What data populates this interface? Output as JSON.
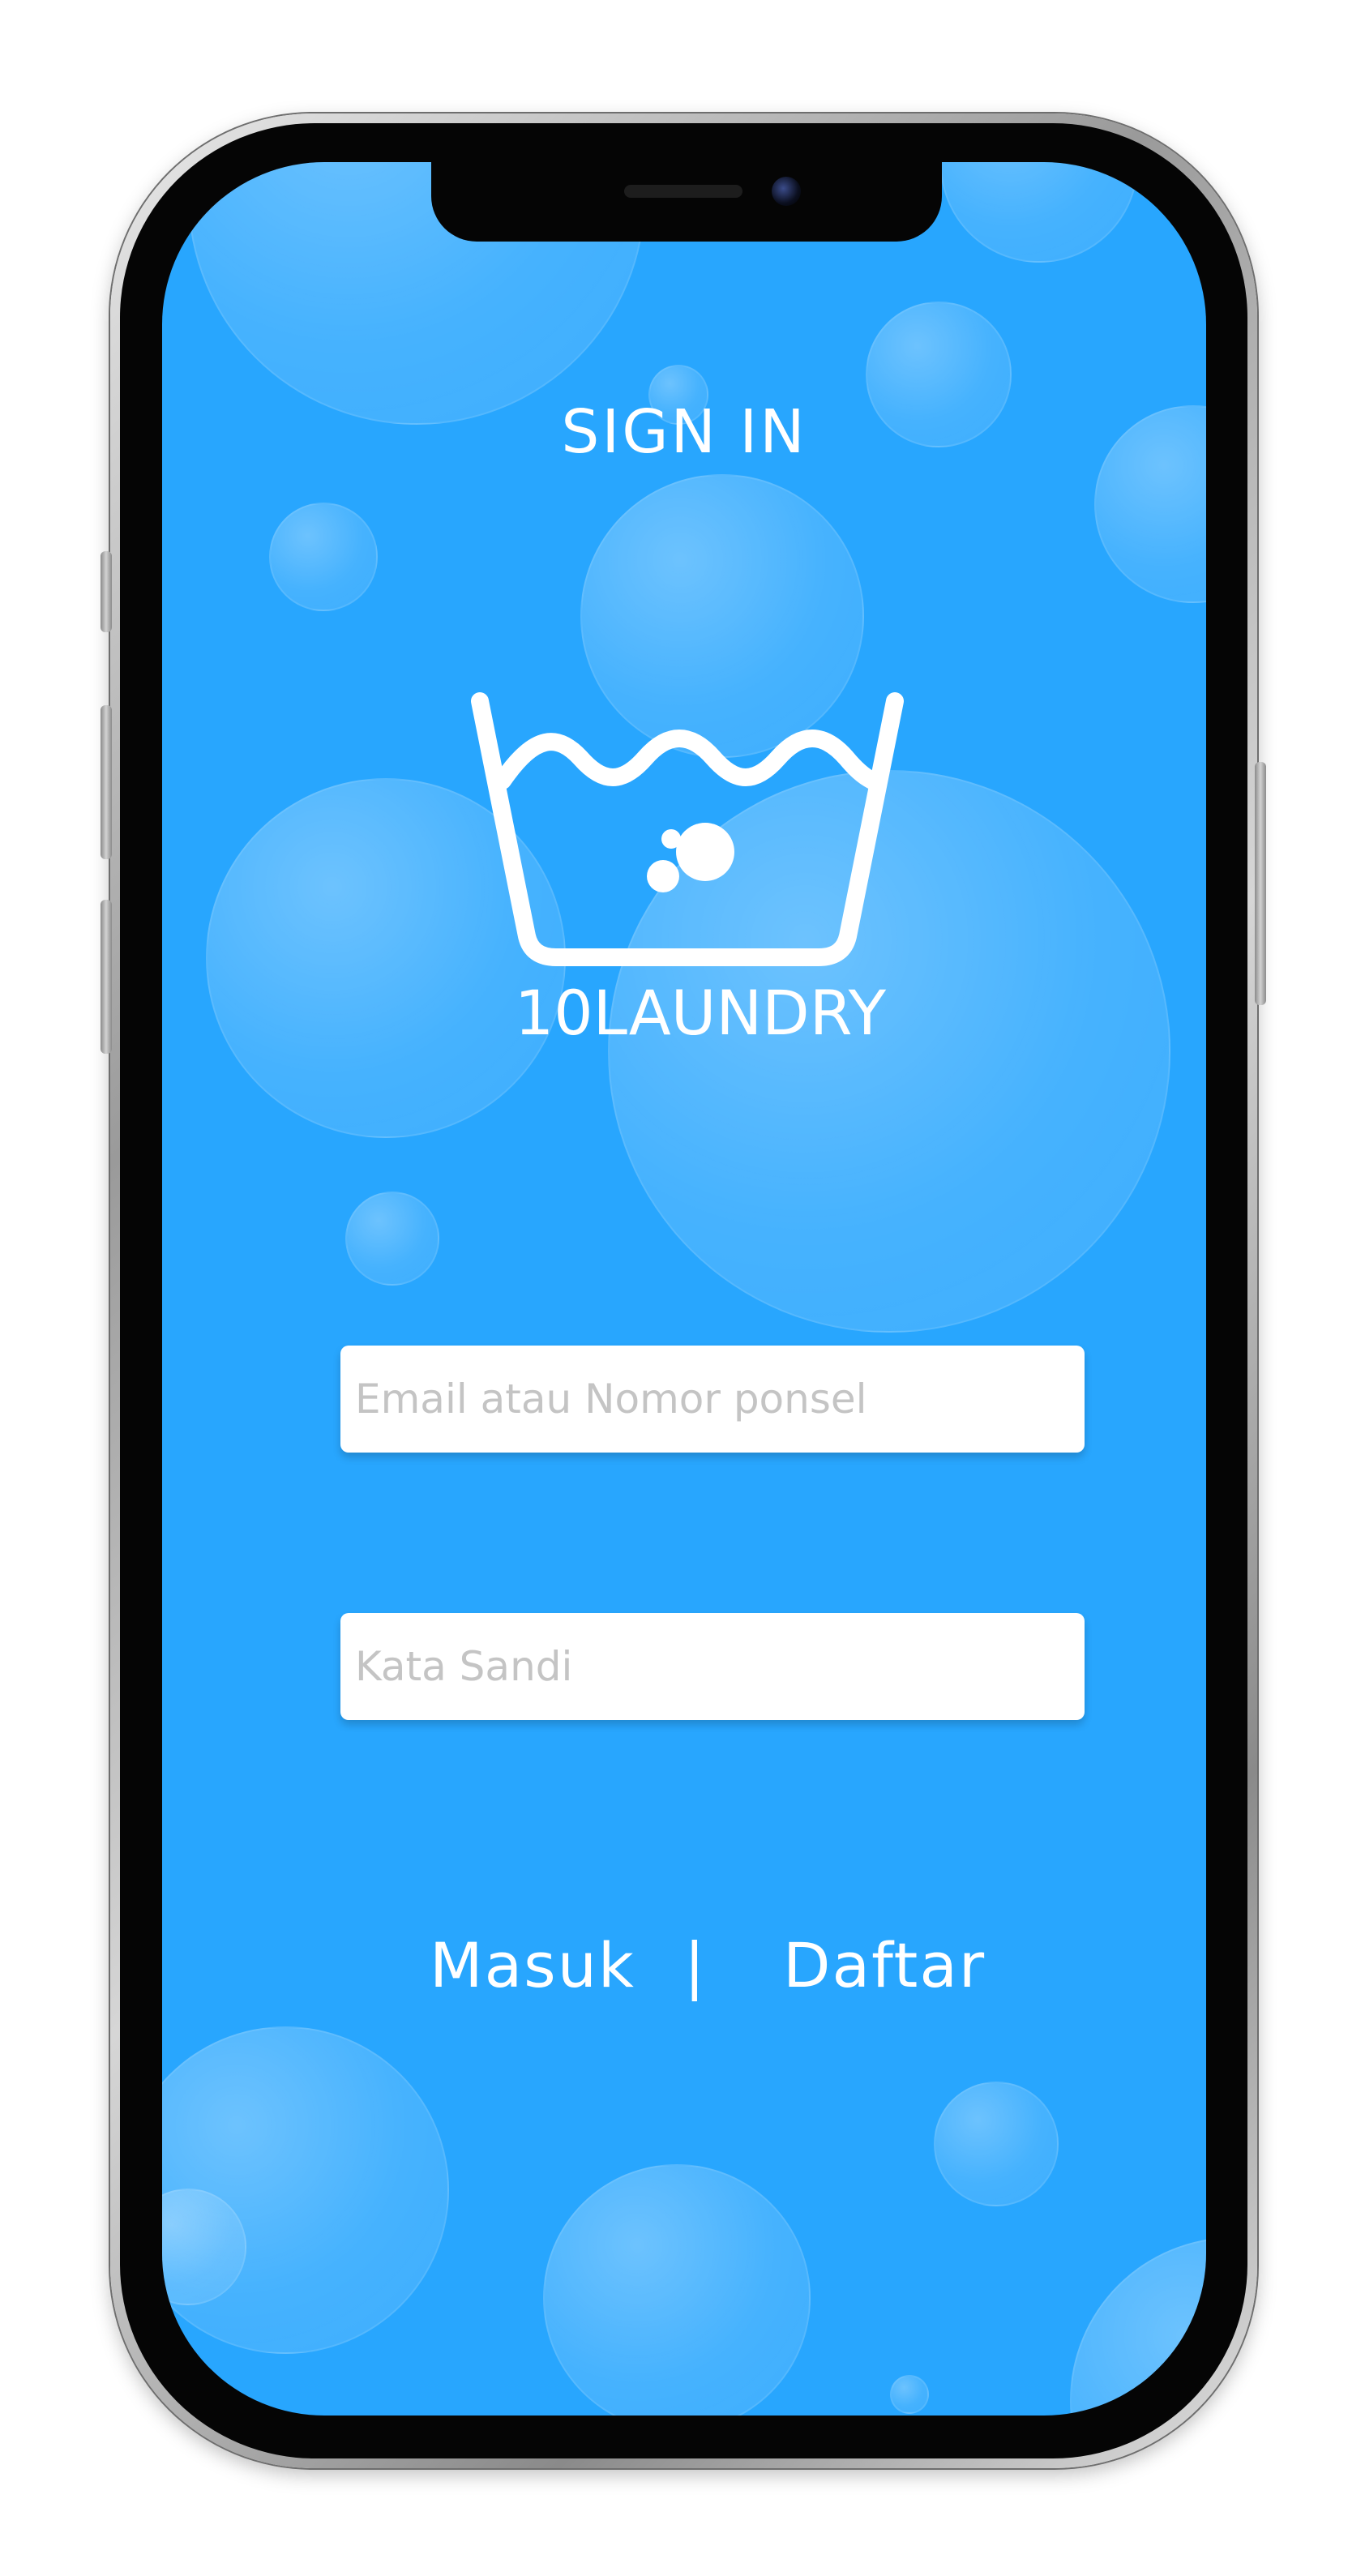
{
  "screen": {
    "title": "SIGN IN",
    "brand_name": "10LAUNDRY",
    "logo_icon": "washbasin-icon",
    "background_color": "#28a6fe"
  },
  "form": {
    "email_placeholder": "Email atau Nomor ponsel",
    "password_placeholder": "Kata Sandi"
  },
  "actions": {
    "login_label": "Masuk",
    "separator": "|",
    "register_label": "Daftar"
  }
}
